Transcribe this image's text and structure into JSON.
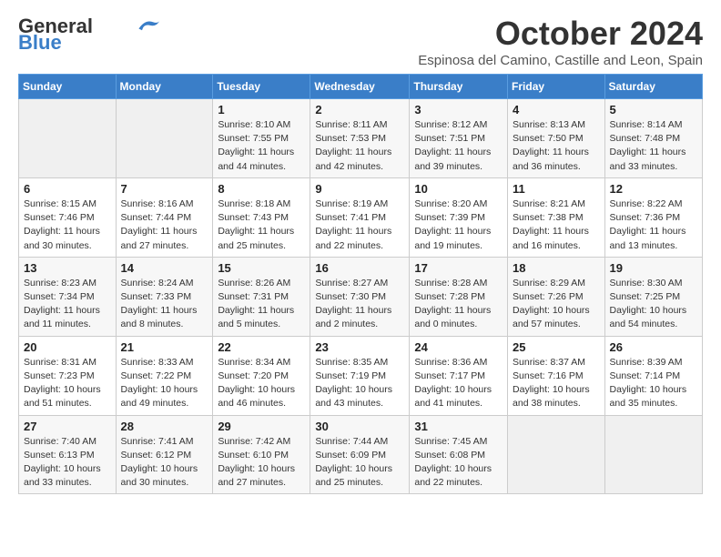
{
  "header": {
    "logo_general": "General",
    "logo_blue": "Blue",
    "month_title": "October 2024",
    "subtitle": "Espinosa del Camino, Castille and Leon, Spain"
  },
  "weekdays": [
    "Sunday",
    "Monday",
    "Tuesday",
    "Wednesday",
    "Thursday",
    "Friday",
    "Saturday"
  ],
  "weeks": [
    [
      {
        "day": "",
        "info": ""
      },
      {
        "day": "",
        "info": ""
      },
      {
        "day": "1",
        "info": "Sunrise: 8:10 AM\nSunset: 7:55 PM\nDaylight: 11 hours and 44 minutes."
      },
      {
        "day": "2",
        "info": "Sunrise: 8:11 AM\nSunset: 7:53 PM\nDaylight: 11 hours and 42 minutes."
      },
      {
        "day": "3",
        "info": "Sunrise: 8:12 AM\nSunset: 7:51 PM\nDaylight: 11 hours and 39 minutes."
      },
      {
        "day": "4",
        "info": "Sunrise: 8:13 AM\nSunset: 7:50 PM\nDaylight: 11 hours and 36 minutes."
      },
      {
        "day": "5",
        "info": "Sunrise: 8:14 AM\nSunset: 7:48 PM\nDaylight: 11 hours and 33 minutes."
      }
    ],
    [
      {
        "day": "6",
        "info": "Sunrise: 8:15 AM\nSunset: 7:46 PM\nDaylight: 11 hours and 30 minutes."
      },
      {
        "day": "7",
        "info": "Sunrise: 8:16 AM\nSunset: 7:44 PM\nDaylight: 11 hours and 27 minutes."
      },
      {
        "day": "8",
        "info": "Sunrise: 8:18 AM\nSunset: 7:43 PM\nDaylight: 11 hours and 25 minutes."
      },
      {
        "day": "9",
        "info": "Sunrise: 8:19 AM\nSunset: 7:41 PM\nDaylight: 11 hours and 22 minutes."
      },
      {
        "day": "10",
        "info": "Sunrise: 8:20 AM\nSunset: 7:39 PM\nDaylight: 11 hours and 19 minutes."
      },
      {
        "day": "11",
        "info": "Sunrise: 8:21 AM\nSunset: 7:38 PM\nDaylight: 11 hours and 16 minutes."
      },
      {
        "day": "12",
        "info": "Sunrise: 8:22 AM\nSunset: 7:36 PM\nDaylight: 11 hours and 13 minutes."
      }
    ],
    [
      {
        "day": "13",
        "info": "Sunrise: 8:23 AM\nSunset: 7:34 PM\nDaylight: 11 hours and 11 minutes."
      },
      {
        "day": "14",
        "info": "Sunrise: 8:24 AM\nSunset: 7:33 PM\nDaylight: 11 hours and 8 minutes."
      },
      {
        "day": "15",
        "info": "Sunrise: 8:26 AM\nSunset: 7:31 PM\nDaylight: 11 hours and 5 minutes."
      },
      {
        "day": "16",
        "info": "Sunrise: 8:27 AM\nSunset: 7:30 PM\nDaylight: 11 hours and 2 minutes."
      },
      {
        "day": "17",
        "info": "Sunrise: 8:28 AM\nSunset: 7:28 PM\nDaylight: 11 hours and 0 minutes."
      },
      {
        "day": "18",
        "info": "Sunrise: 8:29 AM\nSunset: 7:26 PM\nDaylight: 10 hours and 57 minutes."
      },
      {
        "day": "19",
        "info": "Sunrise: 8:30 AM\nSunset: 7:25 PM\nDaylight: 10 hours and 54 minutes."
      }
    ],
    [
      {
        "day": "20",
        "info": "Sunrise: 8:31 AM\nSunset: 7:23 PM\nDaylight: 10 hours and 51 minutes."
      },
      {
        "day": "21",
        "info": "Sunrise: 8:33 AM\nSunset: 7:22 PM\nDaylight: 10 hours and 49 minutes."
      },
      {
        "day": "22",
        "info": "Sunrise: 8:34 AM\nSunset: 7:20 PM\nDaylight: 10 hours and 46 minutes."
      },
      {
        "day": "23",
        "info": "Sunrise: 8:35 AM\nSunset: 7:19 PM\nDaylight: 10 hours and 43 minutes."
      },
      {
        "day": "24",
        "info": "Sunrise: 8:36 AM\nSunset: 7:17 PM\nDaylight: 10 hours and 41 minutes."
      },
      {
        "day": "25",
        "info": "Sunrise: 8:37 AM\nSunset: 7:16 PM\nDaylight: 10 hours and 38 minutes."
      },
      {
        "day": "26",
        "info": "Sunrise: 8:39 AM\nSunset: 7:14 PM\nDaylight: 10 hours and 35 minutes."
      }
    ],
    [
      {
        "day": "27",
        "info": "Sunrise: 7:40 AM\nSunset: 6:13 PM\nDaylight: 10 hours and 33 minutes."
      },
      {
        "day": "28",
        "info": "Sunrise: 7:41 AM\nSunset: 6:12 PM\nDaylight: 10 hours and 30 minutes."
      },
      {
        "day": "29",
        "info": "Sunrise: 7:42 AM\nSunset: 6:10 PM\nDaylight: 10 hours and 27 minutes."
      },
      {
        "day": "30",
        "info": "Sunrise: 7:44 AM\nSunset: 6:09 PM\nDaylight: 10 hours and 25 minutes."
      },
      {
        "day": "31",
        "info": "Sunrise: 7:45 AM\nSunset: 6:08 PM\nDaylight: 10 hours and 22 minutes."
      },
      {
        "day": "",
        "info": ""
      },
      {
        "day": "",
        "info": ""
      }
    ]
  ]
}
